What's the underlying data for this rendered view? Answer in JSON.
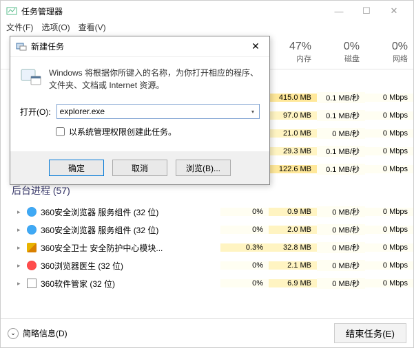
{
  "window": {
    "title": "任务管理器",
    "min": "—",
    "max": "☐",
    "close": "✕"
  },
  "menu": {
    "file": "文件(F)",
    "options": "选项(O)",
    "view": "查看(V)"
  },
  "headers": {
    "cpu": {
      "pct": "47%",
      "lbl": "内存"
    },
    "disk": {
      "pct": "0%",
      "lbl": "磁盘"
    },
    "net": {
      "pct": "0%",
      "lbl": "网络"
    }
  },
  "top_rows": [
    {
      "mem": "415.0 MB",
      "disk": "0.1 MB/秒",
      "net": "0 Mbps",
      "memHigh": true
    },
    {
      "mem": "97.0 MB",
      "disk": "0.1 MB/秒",
      "net": "0 Mbps",
      "memHigh": false
    },
    {
      "mem": "21.0 MB",
      "disk": "0 MB/秒",
      "net": "0 Mbps",
      "memHigh": false
    },
    {
      "mem": "29.3 MB",
      "disk": "0.1 MB/秒",
      "net": "0 Mbps",
      "memHigh": false
    },
    {
      "mem": "122.6 MB",
      "disk": "0.1 MB/秒",
      "net": "0 Mbps",
      "memHigh": true
    }
  ],
  "bg_title": "后台进程 (57)",
  "bg_rows": [
    {
      "icon": "ie",
      "name": "360安全浏览器 服务组件 (32 位)",
      "cpu": "0%",
      "mem": "0.9 MB",
      "disk": "0 MB/秒",
      "net": "0 Mbps"
    },
    {
      "icon": "ie",
      "name": "360安全浏览器 服务组件 (32 位)",
      "cpu": "0%",
      "mem": "2.0 MB",
      "disk": "0 MB/秒",
      "net": "0 Mbps"
    },
    {
      "icon": "shield",
      "name": "360安全卫士 安全防护中心模块...",
      "cpu": "0.3%",
      "mem": "32.8 MB",
      "disk": "0 MB/秒",
      "net": "0 Mbps",
      "cpuHigh": true
    },
    {
      "icon": "red",
      "name": "360浏览器医生 (32 位)",
      "cpu": "0%",
      "mem": "2.1 MB",
      "disk": "0 MB/秒",
      "net": "0 Mbps"
    },
    {
      "icon": "box",
      "name": "360软件管家 (32 位)",
      "cpu": "0%",
      "mem": "6.9 MB",
      "disk": "0 MB/秒",
      "net": "0 Mbps"
    }
  ],
  "footer": {
    "less": "简略信息(D)",
    "end": "结束任务(E)"
  },
  "dialog": {
    "title": "新建任务",
    "message": "Windows 将根据你所键入的名称，为你打开相应的程序、文件夹、文档或 Internet 资源。",
    "open_label": "打开(O):",
    "value": "explorer.exe",
    "admin": "以系统管理权限创建此任务。",
    "ok": "确定",
    "cancel": "取消",
    "browse": "浏览(B)..."
  }
}
